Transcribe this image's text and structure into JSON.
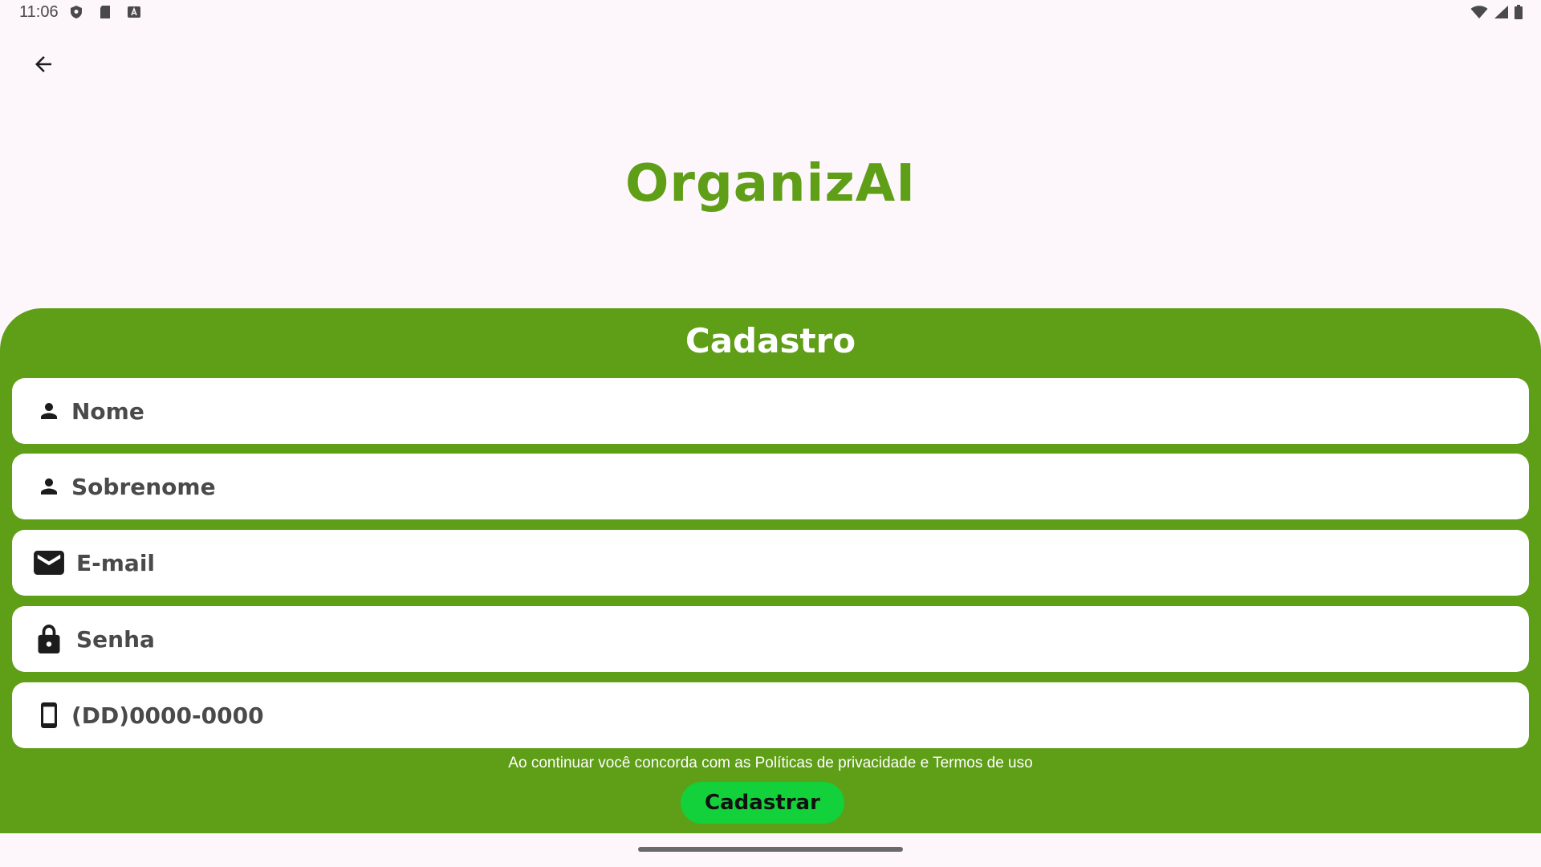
{
  "status_bar": {
    "time": "11:06",
    "left_icons": [
      "shield-icon",
      "sd-card-icon",
      "keyboard-a-icon"
    ],
    "right_icons": [
      "wifi-icon",
      "cell-signal-icon",
      "battery-icon"
    ]
  },
  "header": {
    "back_icon": "arrow-left-icon"
  },
  "app": {
    "title": "OrganizAI",
    "brand_color": "#5f9e17"
  },
  "form": {
    "title": "Cadastro",
    "fields": [
      {
        "icon": "person-icon",
        "placeholder": "Nome",
        "value": ""
      },
      {
        "icon": "person-icon",
        "placeholder": "Sobrenome",
        "value": ""
      },
      {
        "icon": "mail-icon",
        "placeholder": "E-mail",
        "value": ""
      },
      {
        "icon": "lock-icon",
        "placeholder": "Senha",
        "value": ""
      },
      {
        "icon": "phone-icon",
        "placeholder": "(DD)0000-0000",
        "value": ""
      }
    ],
    "terms_text": "Ao continuar você concorda com as Políticas de privacidade e Termos de uso",
    "submit_label": "Cadastrar",
    "submit_color": "#12d13a"
  }
}
